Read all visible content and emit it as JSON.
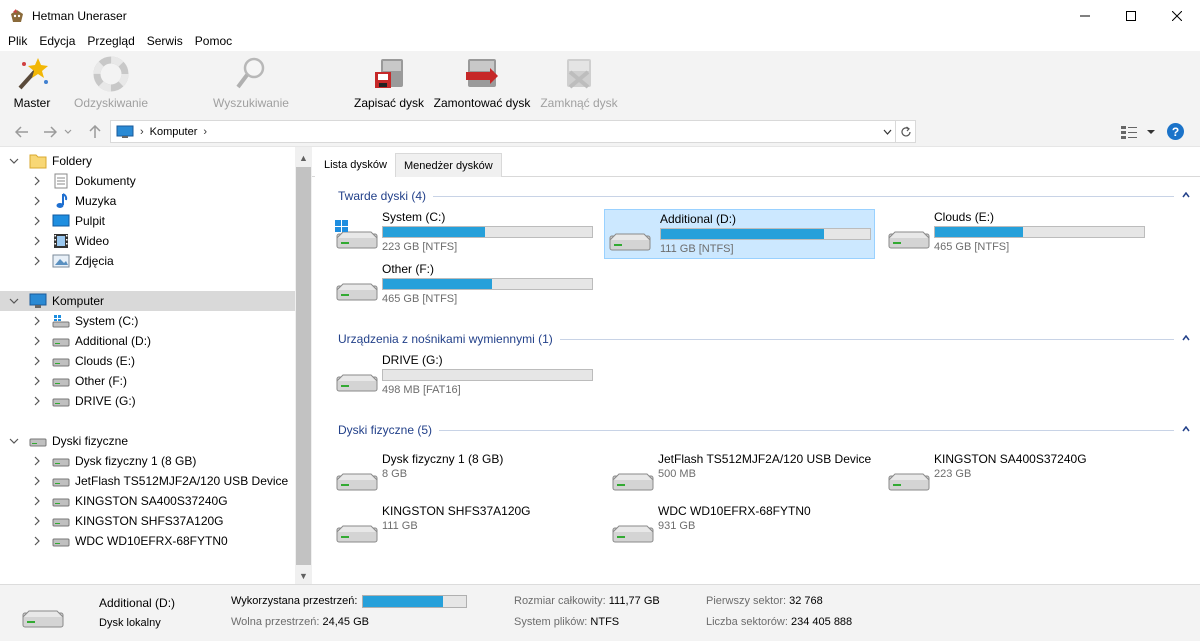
{
  "app": {
    "title": "Hetman Uneraser"
  },
  "window": {
    "minimize": "—",
    "maximize": "☐",
    "close": "✕"
  },
  "menu": [
    "Plik",
    "Edycja",
    "Przegląd",
    "Serwis",
    "Pomoc"
  ],
  "toolbar": {
    "master": "Master",
    "recovery": "Odzyskiwanie",
    "search": "Wyszukiwanie",
    "save_disk": "Zapisać dysk",
    "mount_disk": "Zamontować dysk",
    "close_disk": "Zamknąć dysk"
  },
  "address": {
    "crumb": "Komputer",
    "separator": "›"
  },
  "tree": {
    "folders": {
      "label": "Foldery",
      "items": [
        "Dokumenty",
        "Muzyka",
        "Pulpit",
        "Wideo",
        "Zdjęcia"
      ]
    },
    "computer": {
      "label": "Komputer",
      "items": [
        "System (C:)",
        "Additional (D:)",
        "Clouds (E:)",
        "Other (F:)",
        "DRIVE (G:)"
      ]
    },
    "physical": {
      "label": "Dyski fizyczne",
      "items": [
        "Dysk fizyczny 1 (8 GB)",
        "JetFlash TS512MJF2A/120 USB Device",
        "KINGSTON SA400S37240G",
        "KINGSTON SHFS37A120G",
        "WDC WD10EFRX-68FYTN0"
      ]
    }
  },
  "tabs": [
    "Lista dysków",
    "Menedżer dysków"
  ],
  "groups": {
    "hard": "Twarde dyski (4)",
    "removable": "Urządzenia z nośnikami wymiennymi (1)",
    "physical": "Dyski fizyczne (5)"
  },
  "hard_disks": [
    {
      "name": "System (C:)",
      "info": "223 GB [NTFS]",
      "used": 0.49
    },
    {
      "name": "Additional (D:)",
      "info": "111 GB [NTFS]",
      "used": 0.78
    },
    {
      "name": "Clouds (E:)",
      "info": "465 GB [NTFS]",
      "used": 0.42
    },
    {
      "name": "Other (F:)",
      "info": "465 GB [NTFS]",
      "used": 0.52
    }
  ],
  "removable_disks": [
    {
      "name": "DRIVE (G:)",
      "info": "498 MB [FAT16]",
      "used": 0.0
    }
  ],
  "physical_disks": [
    {
      "name": "Dysk fizyczny 1 (8 GB)",
      "info": "8 GB"
    },
    {
      "name": "JetFlash TS512MJF2A/120 USB Device",
      "info": "500 MB"
    },
    {
      "name": "KINGSTON SA400S37240G",
      "info": "223 GB"
    },
    {
      "name": "KINGSTON SHFS37A120G",
      "info": "111 GB"
    },
    {
      "name": "WDC WD10EFRX-68FYTN0",
      "info": "931 GB"
    }
  ],
  "status": {
    "name": "Additional (D:)",
    "type": "Dysk lokalny",
    "used_label": "Wykorzystana przestrzeń:",
    "used_fraction": 0.78,
    "free_label": "Wolna przestrzeń:",
    "free_value": "24,45 GB",
    "total_label": "Rozmiar całkowity:",
    "total_value": "111,77 GB",
    "fs_label": "System plików:",
    "fs_value": "NTFS",
    "first_sector_label": "Pierwszy sektor:",
    "first_sector_value": "32 768",
    "sectors_label": "Liczba sektorów:",
    "sectors_value": "234 405 888"
  },
  "colors": {
    "accent": "#26a0da",
    "selection": "#cce8ff",
    "group_text": "#23418a"
  }
}
